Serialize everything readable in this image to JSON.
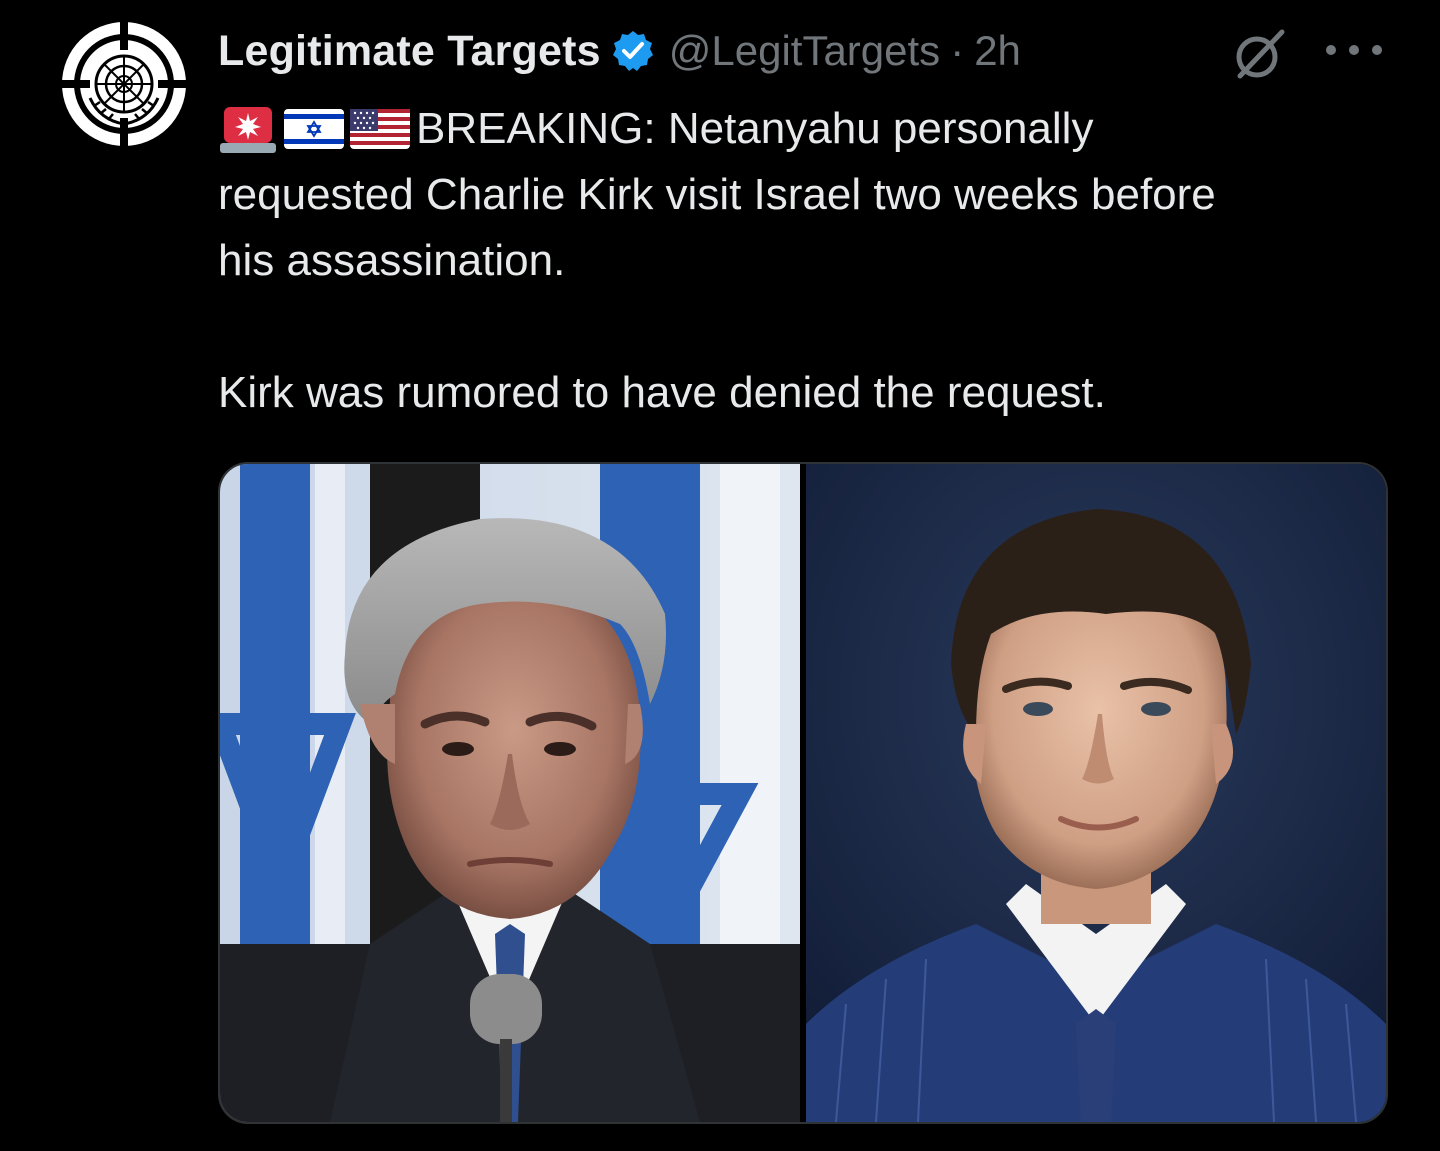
{
  "post": {
    "author": {
      "display_name": "Legitimate Targets",
      "handle": "@LegitTargets",
      "avatar_icon": "crosshair-globe-logo",
      "verified_icon": "verified-badge-icon"
    },
    "separator": "·",
    "timestamp": "2h",
    "actions": {
      "grok_icon": "grok-icon",
      "more_icon": "more-options-icon"
    },
    "text": {
      "emojis": [
        "rotating-light-emoji",
        "israel-flag-emoji",
        "us-flag-emoji"
      ],
      "line1": "BREAKING: Netanyahu personally",
      "line2": "requested Charlie Kirk visit Israel two weeks before",
      "line3": "his assassination.",
      "paragraph2": "Kirk was rumored to have denied the request."
    },
    "media": {
      "left_photo": "photo-man-grey-hair-israel-flags",
      "right_photo": "photo-man-dark-hair-blue-suit"
    }
  },
  "colors": {
    "background": "#000000",
    "text_primary": "#e7e9ea",
    "text_secondary": "#71767b",
    "verified_blue": "#1d9bf0",
    "border": "#2f3336"
  }
}
